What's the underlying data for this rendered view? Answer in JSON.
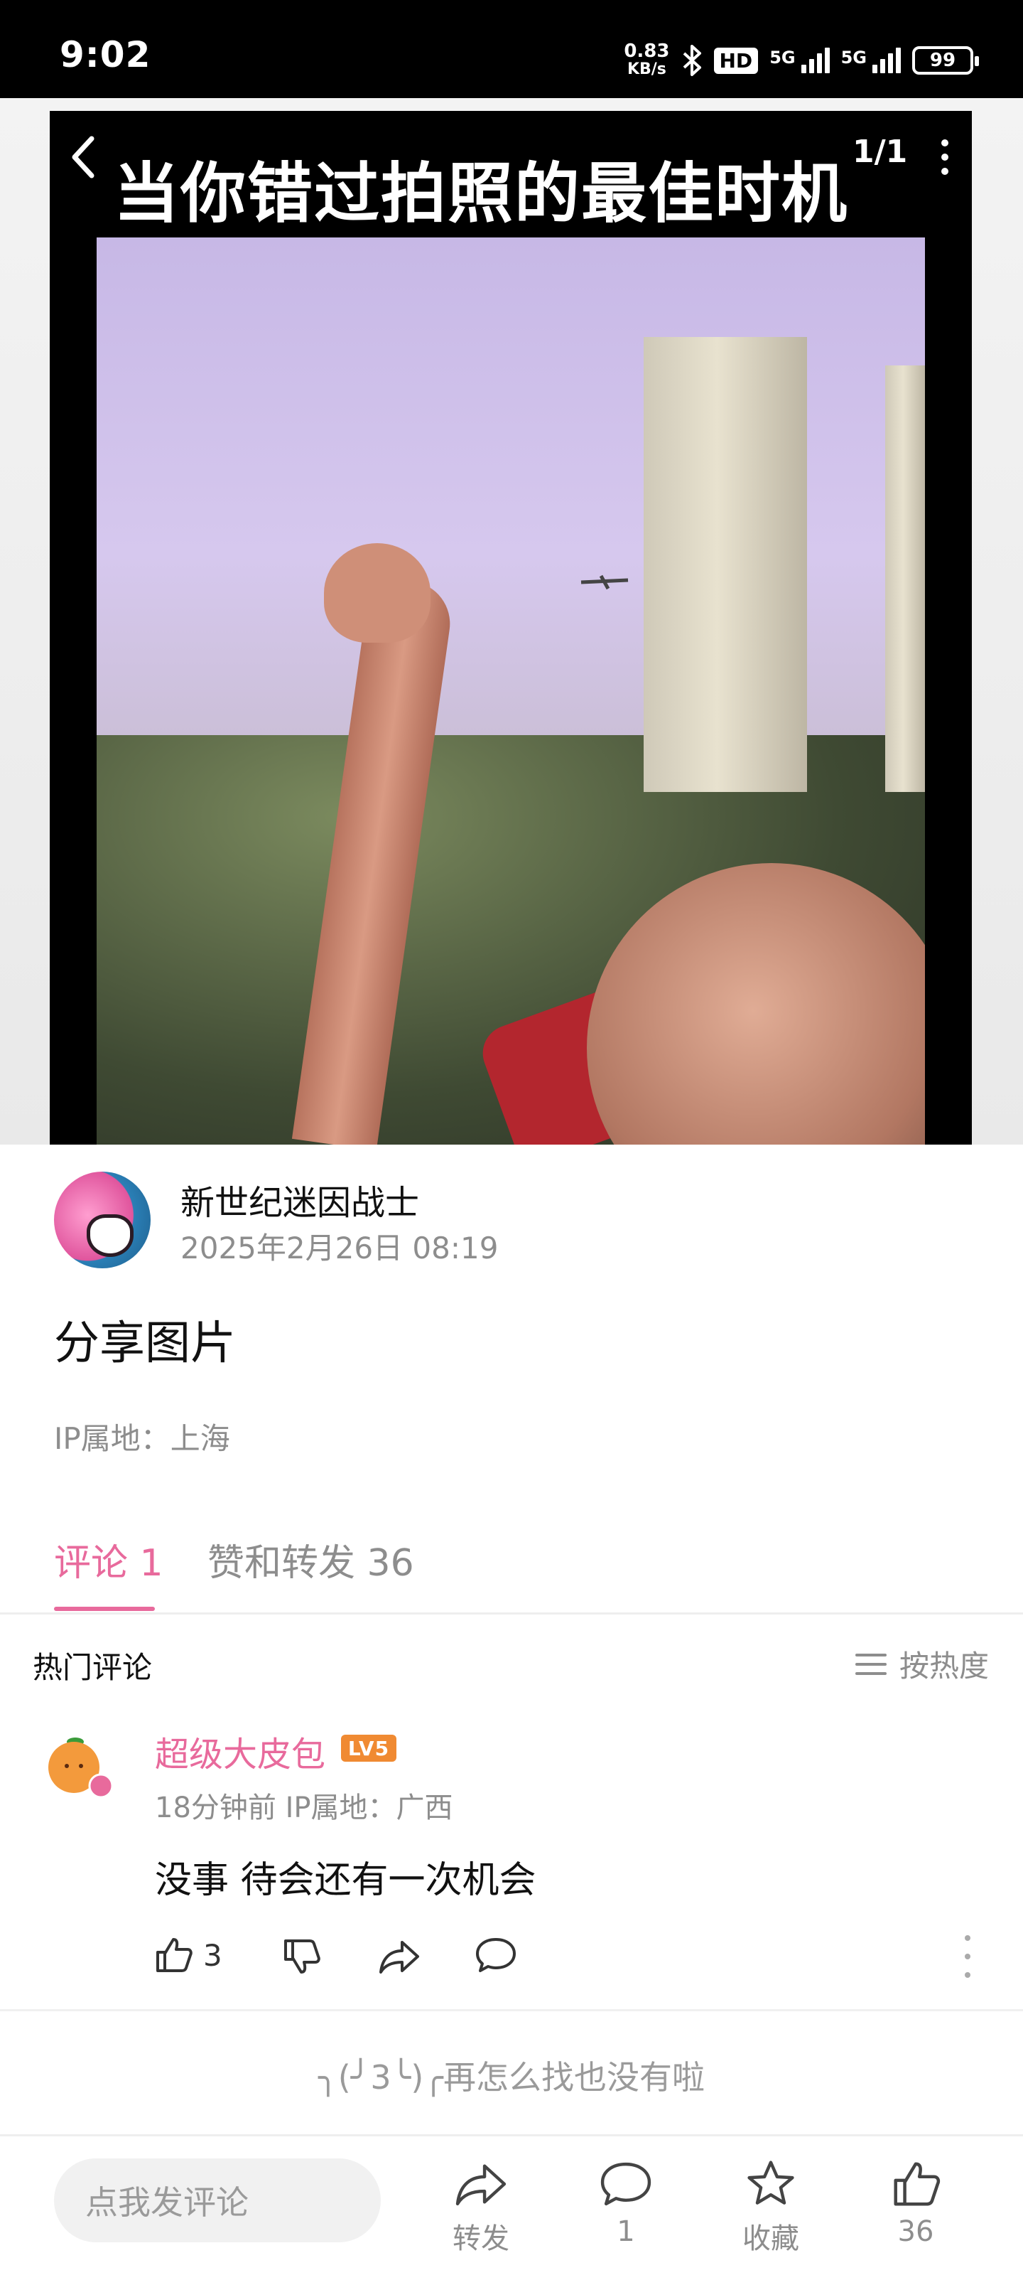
{
  "status_bar": {
    "time": "9:02",
    "net_speed_value": "0.83",
    "net_speed_unit": "KB/s",
    "hd_label": "HD",
    "signal1_label": "5G",
    "signal2_label": "5G",
    "battery": "99"
  },
  "viewer": {
    "caption": "当你错过拍照的最佳时机",
    "page_counter": "1/1"
  },
  "post": {
    "author_name": "新世纪迷因战士",
    "time": "2025年2月26日 08:19",
    "text": "分享图片",
    "ip_location": "IP属地：上海"
  },
  "tabs": {
    "comments": "评论 1",
    "likes": "赞和转发 36"
  },
  "comments_section": {
    "title": "热门评论",
    "sort_label": "按热度"
  },
  "comment": {
    "user_name": "超级大皮包",
    "level": "LV5",
    "meta": "18分钟前 IP属地：广西",
    "text": "没事  待会还有一次机会",
    "like_count": "3"
  },
  "end_hint": "╮(╯3╰)╭再怎么找也没有啦",
  "bottom_bar": {
    "input_placeholder": "点我发评论",
    "share_label": "转发",
    "comment_count": "1",
    "collect_label": "收藏",
    "like_count": "36"
  },
  "colors": {
    "accent": "#e86a9c",
    "level_badge": "#f08a32"
  }
}
